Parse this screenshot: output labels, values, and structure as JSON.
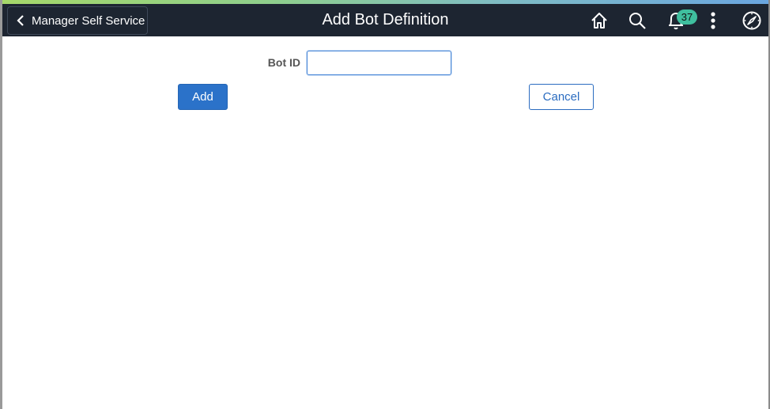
{
  "banner": {
    "back_label": "Manager Self Service",
    "title": "Add Bot Definition",
    "icons": {
      "home": "home-icon",
      "search": "search-icon",
      "notifications": "bell-icon",
      "actions": "more-vertical-icon",
      "navigator": "compass-icon"
    },
    "notification_count": "37"
  },
  "form": {
    "bot_id_label": "Bot ID",
    "bot_id_value": "",
    "add_label": "Add",
    "cancel_label": "Cancel"
  },
  "colors": {
    "banner_bg": "#1d2531",
    "primary_button": "#2b72c9",
    "badge": "#3fbf9e"
  }
}
